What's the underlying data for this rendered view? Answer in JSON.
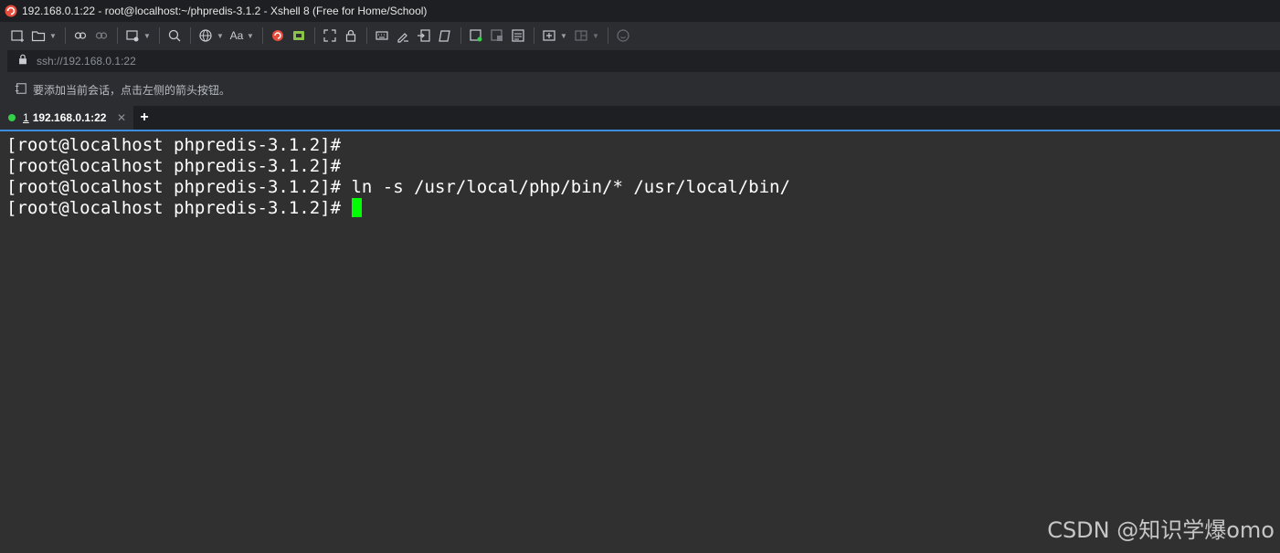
{
  "window": {
    "title": "192.168.0.1:22 - root@localhost:~/phpredis-3.1.2 - Xshell 8 (Free for Home/School)",
    "app_icon": "xshell-icon"
  },
  "toolbar": {
    "items": [
      "new-session-icon",
      "open-folder-icon",
      "reconnect-icon",
      "disconnect-icon",
      "new-window-icon",
      "find-icon",
      "globe-icon",
      "font-icon",
      "xshell-red-icon",
      "xftp-green-icon",
      "fullscreen-icon",
      "lock-icon",
      "keyboard-icon",
      "script-icon",
      "transfer-icon",
      "compose-icon",
      "new-tab-icon",
      "tab-list-icon",
      "tab-layout-icon",
      "layout-icon",
      "chat-icon"
    ],
    "font_label": "Aa"
  },
  "address": {
    "value": "ssh://192.168.0.1:22"
  },
  "hint": {
    "text": "要添加当前会话，点击左侧的箭头按钮。"
  },
  "tabs": [
    {
      "number": "1",
      "label": "192.168.0.1:22",
      "status_color": "#35d04a"
    }
  ],
  "newtab_label": "+",
  "terminal": {
    "lines": [
      "[root@localhost phpredis-3.1.2]#",
      "[root@localhost phpredis-3.1.2]#",
      "[root@localhost phpredis-3.1.2]# ln -s /usr/local/php/bin/* /usr/local/bin/",
      "[root@localhost phpredis-3.1.2]# "
    ],
    "cursor_color": "#00ff00"
  },
  "watermark": "CSDN @知识学爆omo"
}
